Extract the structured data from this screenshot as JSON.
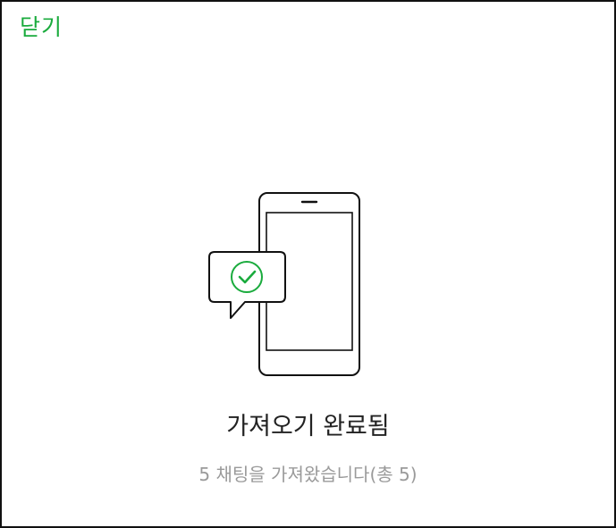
{
  "header": {
    "close_label": "닫기"
  },
  "illustration": {
    "icons": [
      "phone-icon",
      "speech-bubble-icon",
      "check-circle-icon"
    ]
  },
  "status": {
    "title": "가져오기 완료됨",
    "summary": "5 채팅을 가져왔습니다(총 5)"
  },
  "colors": {
    "accent": "#1aab3d",
    "title_text": "#222222",
    "summary_text": "#9a9a9a",
    "outline": "#111111"
  }
}
